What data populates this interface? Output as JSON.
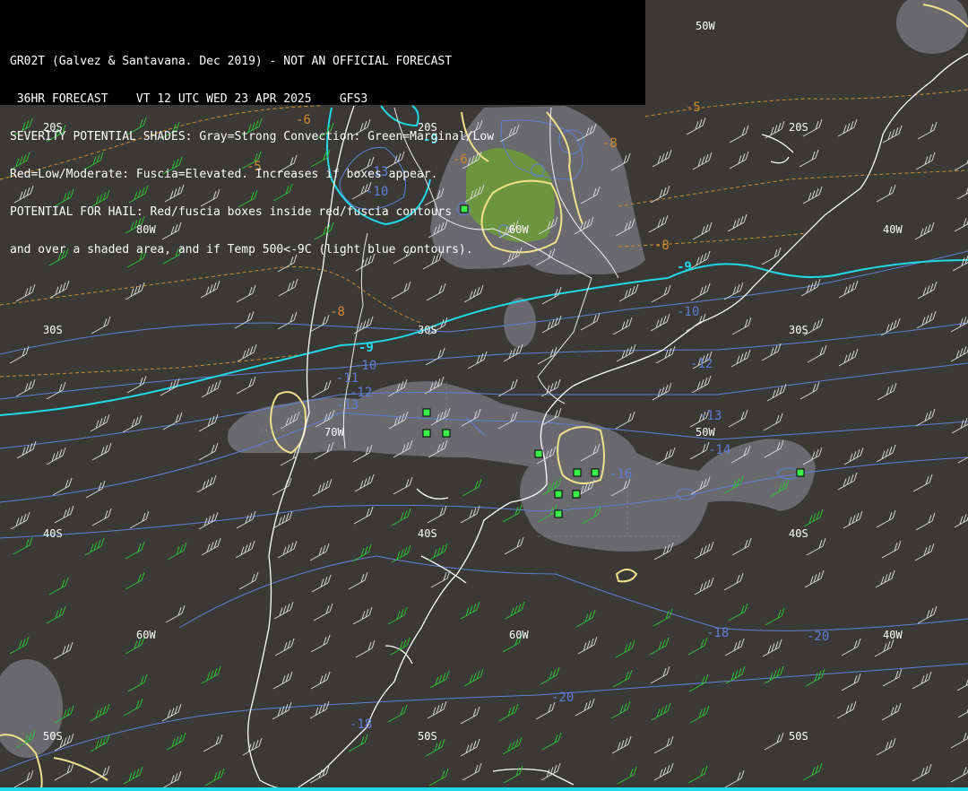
{
  "header": {
    "lines": [
      "GR02T (Galvez & Santavana. Dec 2019) - NOT AN OFFICIAL FORECAST",
      " 36HR FORECAST    VT 12 UTC WED 23 APR 2025    GFS3",
      "SEVERITY POTENTIAL SHADES: Gray=Strong Convection: Green=Marginal/Low",
      "Red=Low/Moderate: Fuscia=Elevated. Increases if boxes appear.",
      "POTENTIAL FOR HAIL: Red/fuscia boxes inside red/fuscia contours",
      "and over a shaded area, and if Temp 500<-9C (light blue contours)."
    ]
  },
  "grid_labels": {
    "lat_20": "20S",
    "lat_30": "30S",
    "lat_40": "40S",
    "lat_50": "50S",
    "lon_80": "80W",
    "lon_70": "70W",
    "lon_60": "60W",
    "lon_50": "50W",
    "lon_40": "40W"
  },
  "contour_labels": {
    "cyan": [
      "-9",
      "-9",
      "-9"
    ],
    "blue": [
      "-10",
      "-10",
      "-11",
      "-12",
      "-13",
      "-12",
      "-13",
      "-14",
      "-16",
      "-18",
      "-18",
      "-20",
      "-20",
      "-10",
      "-13"
    ],
    "orange": [
      "-6",
      "-6",
      "-5",
      "-5",
      "-8",
      "-8",
      "-8"
    ]
  },
  "colors": {
    "background": "#3a3936",
    "coast": "#ffffff",
    "temp500_cyan": "#1fd8e8",
    "temp500_blue": "#5f7fd6",
    "orange_dash": "#d08a2c",
    "yellow_contour": "#f0e08a",
    "gray_shade": "#7a7a82",
    "green_shade": "#6e9a3a",
    "green_box": "#3cf04a",
    "wind_barb_white": "#d8d8d8",
    "wind_barb_green": "#2ec236"
  },
  "legend_symbols": {
    "hail_box": "green-square-icon"
  }
}
